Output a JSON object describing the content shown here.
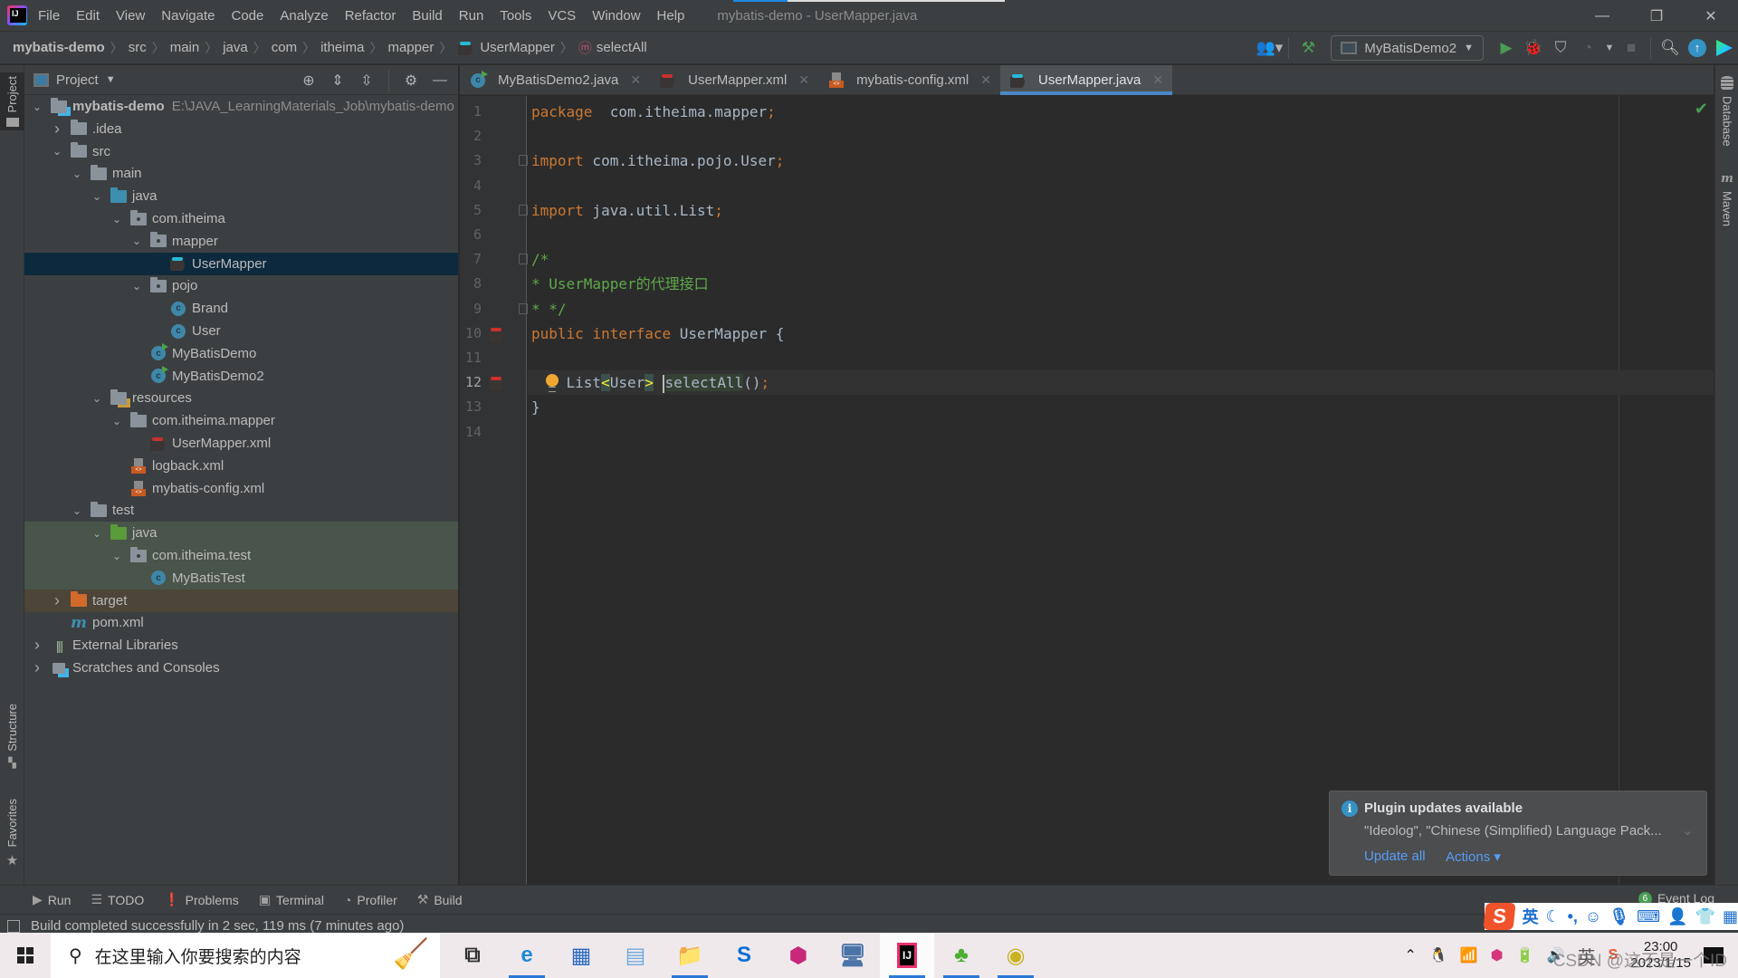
{
  "window": {
    "title": "mybatis-demo - UserMapper.java",
    "menu": [
      "File",
      "Edit",
      "View",
      "Navigate",
      "Code",
      "Analyze",
      "Refactor",
      "Build",
      "Run",
      "Tools",
      "VCS",
      "Window",
      "Help"
    ],
    "controls": {
      "minimize": "—",
      "restore": "❐",
      "close": "✕"
    },
    "title_progress": 0.2
  },
  "breadcrumb": {
    "items": [
      "mybatis-demo",
      "src",
      "main",
      "java",
      "com",
      "itheima",
      "mapper",
      "UserMapper",
      "selectAll"
    ]
  },
  "toolbar": {
    "run_config": "MyBatisDemo2",
    "icons": [
      "user-icon",
      "build-hammer-icon",
      "run-icon",
      "debug-icon",
      "coverage-icon",
      "profile-icon",
      "stop-icon",
      "search-icon",
      "update-icon",
      "code-with-me-icon"
    ]
  },
  "left_stripe": {
    "project": "Project",
    "structure": "Structure",
    "favorites": "Favorites"
  },
  "right_stripe": {
    "database": "Database",
    "maven": "Maven"
  },
  "project_panel": {
    "title": "Project",
    "tree": [
      {
        "label": "mybatis-demo",
        "path": "E:\\JAVA_LearningMaterials_Job\\mybatis-demo",
        "depth": 0,
        "expanded": true,
        "icon": "module-folder-icon"
      },
      {
        "label": ".idea",
        "depth": 1,
        "expanded": false,
        "icon": "folder-icon"
      },
      {
        "label": "src",
        "depth": 1,
        "expanded": true,
        "icon": "folder-icon"
      },
      {
        "label": "main",
        "depth": 2,
        "expanded": true,
        "icon": "folder-icon"
      },
      {
        "label": "java",
        "depth": 3,
        "expanded": true,
        "icon": "source-folder-icon"
      },
      {
        "label": "com.itheima",
        "depth": 4,
        "expanded": true,
        "icon": "package-icon"
      },
      {
        "label": "mapper",
        "depth": 5,
        "expanded": true,
        "icon": "package-icon"
      },
      {
        "label": "UserMapper",
        "depth": 6,
        "icon": "mybatis-interface-icon",
        "selected": true
      },
      {
        "label": "pojo",
        "depth": 5,
        "expanded": true,
        "icon": "package-icon"
      },
      {
        "label": "Brand",
        "depth": 6,
        "icon": "class-icon"
      },
      {
        "label": "User",
        "depth": 6,
        "icon": "class-icon"
      },
      {
        "label": "MyBatisDemo",
        "depth": 5,
        "icon": "main-class-icon"
      },
      {
        "label": "MyBatisDemo2",
        "depth": 5,
        "icon": "main-class-icon"
      },
      {
        "label": "resources",
        "depth": 3,
        "expanded": true,
        "icon": "resources-folder-icon"
      },
      {
        "label": "com.itheima.mapper",
        "depth": 4,
        "expanded": true,
        "icon": "folder-icon"
      },
      {
        "label": "UserMapper.xml",
        "depth": 5,
        "icon": "mybatis-xml-icon"
      },
      {
        "label": "logback.xml",
        "depth": 4,
        "icon": "xml-file-icon"
      },
      {
        "label": "mybatis-config.xml",
        "depth": 4,
        "icon": "xml-file-icon"
      },
      {
        "label": "test",
        "depth": 2,
        "expanded": true,
        "icon": "folder-icon"
      },
      {
        "label": "java",
        "depth": 3,
        "expanded": true,
        "icon": "test-folder-icon",
        "test": true
      },
      {
        "label": "com.itheima.test",
        "depth": 4,
        "expanded": true,
        "icon": "package-icon",
        "test": true
      },
      {
        "label": "MyBatisTest",
        "depth": 5,
        "icon": "class-icon",
        "test": true
      },
      {
        "label": "target",
        "depth": 1,
        "expanded": false,
        "icon": "excluded-folder-icon",
        "excluded": true
      },
      {
        "label": "pom.xml",
        "depth": 1,
        "icon": "maven-icon"
      },
      {
        "label": "External Libraries",
        "depth": 0,
        "expanded": false,
        "icon": "libraries-icon"
      },
      {
        "label": "Scratches and Consoles",
        "depth": 0,
        "expanded": false,
        "icon": "scratches-icon"
      }
    ]
  },
  "editor": {
    "tabs": [
      {
        "label": "MyBatisDemo2.java",
        "icon": "main-class-icon",
        "active": false
      },
      {
        "label": "UserMapper.xml",
        "icon": "mybatis-xml-icon",
        "active": false
      },
      {
        "label": "mybatis-config.xml",
        "icon": "xml-file-icon",
        "active": false
      },
      {
        "label": "UserMapper.java",
        "icon": "mybatis-interface-icon",
        "active": true
      }
    ],
    "current_line": 12,
    "lines": [
      {
        "n": "1",
        "tokens": [
          [
            "kw",
            "package"
          ],
          [
            "",
            "  com.itheima.mapper"
          ],
          [
            "kw",
            ";"
          ]
        ]
      },
      {
        "n": "2",
        "tokens": []
      },
      {
        "n": "3",
        "tokens": [
          [
            "kw",
            "import"
          ],
          [
            "",
            " com.itheima.pojo.User"
          ],
          [
            "kw",
            ";"
          ]
        ]
      },
      {
        "n": "4",
        "tokens": []
      },
      {
        "n": "5",
        "tokens": [
          [
            "kw",
            "import"
          ],
          [
            "",
            " java.util.List"
          ],
          [
            "kw",
            ";"
          ]
        ]
      },
      {
        "n": "6",
        "tokens": []
      },
      {
        "n": "7",
        "tokens": [
          [
            "cm",
            "/*"
          ]
        ]
      },
      {
        "n": "8",
        "tokens": [
          [
            "cm",
            "* UserMapper的代理接口"
          ]
        ]
      },
      {
        "n": "9",
        "tokens": [
          [
            "cm",
            "* */"
          ]
        ]
      },
      {
        "n": "10",
        "tokens": [
          [
            "kw",
            "public"
          ],
          [
            "",
            " "
          ],
          [
            "kw",
            "interface"
          ],
          [
            "",
            " UserMapper {"
          ]
        ]
      },
      {
        "n": "11",
        "tokens": []
      },
      {
        "n": "12",
        "tokens": [
          [
            "",
            "    List"
          ],
          [
            "br",
            "<"
          ],
          [
            "",
            "User"
          ],
          [
            "br",
            ">"
          ],
          [
            "",
            " "
          ],
          [
            "caret",
            ""
          ],
          [
            "hl",
            "selectAll"
          ],
          [
            "",
            "()"
          ],
          [
            "kw",
            ";"
          ]
        ]
      },
      {
        "n": "13",
        "tokens": [
          [
            "",
            "}"
          ]
        ]
      },
      {
        "n": "14",
        "tokens": []
      }
    ]
  },
  "notification": {
    "title": "Plugin updates available",
    "body": "\"Ideolog\", \"Chinese (Simplified) Language Pack...",
    "update_all": "Update all",
    "actions": "Actions ▾"
  },
  "tool_tabs": [
    {
      "label": "Run",
      "icon": "▶"
    },
    {
      "label": "TODO",
      "icon": "☰"
    },
    {
      "label": "Problems",
      "icon": "❗"
    },
    {
      "label": "Terminal",
      "icon": "▣"
    },
    {
      "label": "Profiler",
      "icon": "◔"
    },
    {
      "label": "Build",
      "icon": "⚒"
    }
  ],
  "event_log": {
    "count": "6",
    "label": "Event Log"
  },
  "status": {
    "message": "Build completed successfully in 2 sec, 119 ms (7 minutes ago)"
  },
  "ime": {
    "logo": "S",
    "lang": "英"
  },
  "taskbar": {
    "search_placeholder": "在这里输入你要搜索的内容",
    "apps": [
      {
        "name": "task-view",
        "glyph": "⧉",
        "running": false
      },
      {
        "name": "edge",
        "glyph": "e",
        "running": true
      },
      {
        "name": "microsoft-store",
        "glyph": "▦",
        "running": false
      },
      {
        "name": "notepad",
        "glyph": "▤",
        "running": false
      },
      {
        "name": "file-explorer",
        "glyph": "📁",
        "running": true
      },
      {
        "name": "app-s",
        "glyph": "S",
        "running": false
      },
      {
        "name": "jetbrains-toolbox",
        "glyph": "⬢",
        "running": false
      },
      {
        "name": "network-app",
        "glyph": "🖥",
        "running": false
      },
      {
        "name": "intellij-idea",
        "glyph": "IJ",
        "running": true,
        "active": true
      },
      {
        "name": "green-app",
        "glyph": "♣",
        "running": true
      },
      {
        "name": "yellow-app",
        "glyph": "◉",
        "running": true
      }
    ],
    "tray": {
      "lang": "英",
      "time": "23:00",
      "date": "2023/1/15"
    },
    "watermark": "CSDN @这不是一个ID"
  }
}
